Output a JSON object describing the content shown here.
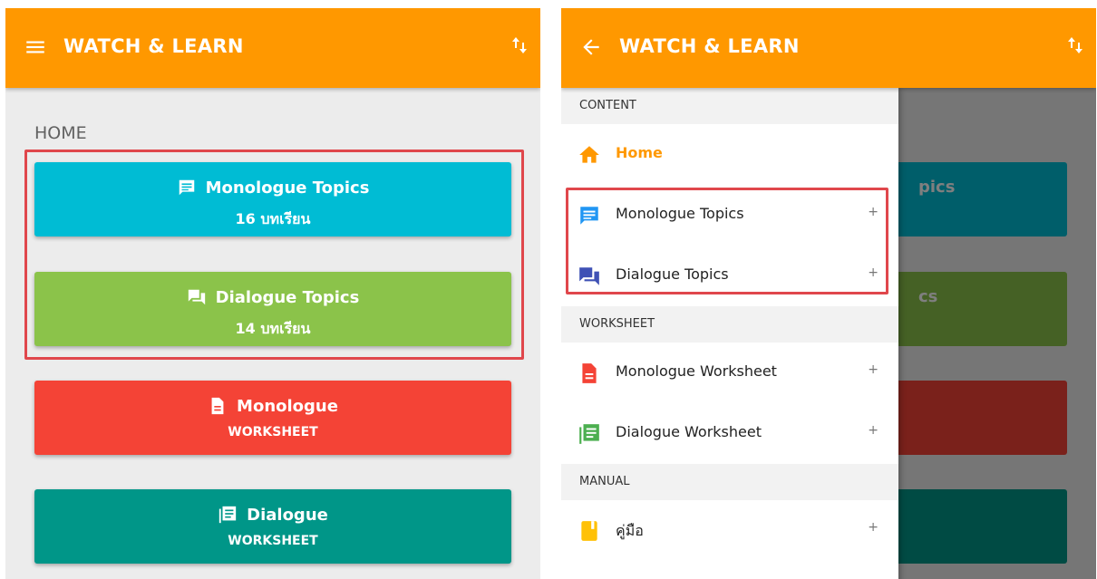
{
  "left": {
    "appbar": {
      "title": "WATCH & LEARN",
      "nav_icon": "menu-icon",
      "action_icon": "sort-icon"
    },
    "section_label": "HOME",
    "cards": [
      {
        "icon": "message-icon",
        "title": "Monologue Topics",
        "subtitle": "16 บทเรียน",
        "color": "#00bcd4"
      },
      {
        "icon": "forum-icon",
        "title": "Dialogue Topics",
        "subtitle": "14 บทเรียน",
        "color": "#8bc34a"
      },
      {
        "icon": "file-icon",
        "title": "Monologue",
        "subtitle": "WORKSHEET",
        "color": "#f44336"
      },
      {
        "icon": "list-icon",
        "title": "Dialogue",
        "subtitle": "WORKSHEET",
        "color": "#009688"
      }
    ]
  },
  "right": {
    "appbar": {
      "title": "WATCH & LEARN",
      "nav_icon": "back-arrow-icon",
      "action_icon": "sort-icon"
    },
    "background_peek": [
      "pics",
      "cs"
    ],
    "drawer": {
      "sections": [
        {
          "header": "CONTENT",
          "items": [
            {
              "label": "Home",
              "icon": "home-icon",
              "icon_color": "#ff9800",
              "active": true
            },
            {
              "label": "Monologue Topics",
              "icon": "message-icon",
              "icon_color": "#2196f3",
              "expand": "+"
            },
            {
              "label": "Dialogue Topics",
              "icon": "forum-icon",
              "icon_color": "#3f51b5",
              "expand": "+"
            }
          ]
        },
        {
          "header": "WORKSHEET",
          "items": [
            {
              "label": "Monologue Worksheet",
              "icon": "file-icon",
              "icon_color": "#f44336",
              "expand": "+"
            },
            {
              "label": "Dialogue Worksheet",
              "icon": "list-icon",
              "icon_color": "#4caf50",
              "expand": "+"
            }
          ]
        },
        {
          "header": "MANUAL",
          "items": [
            {
              "label": "คู่มือ",
              "icon": "book-icon",
              "icon_color": "#ffc107",
              "expand": "+"
            }
          ]
        }
      ]
    }
  },
  "colors": {
    "appbar": "#ff9800",
    "highlight": "#e0474c"
  }
}
